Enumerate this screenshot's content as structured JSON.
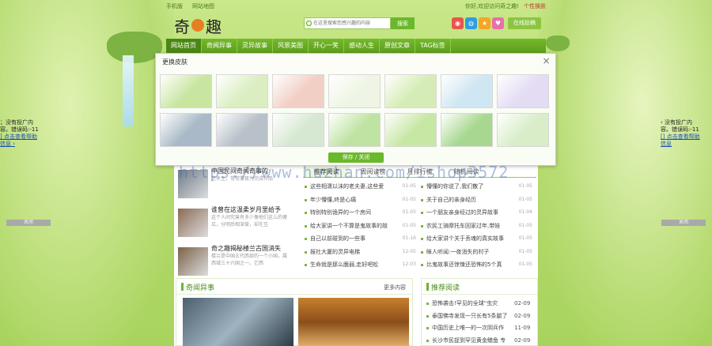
{
  "topbar": {
    "mobile": "手机版",
    "sitemap": "网站地图",
    "greeting": "你好,欢迎访问奇之趣!",
    "personal": "个性换肤"
  },
  "logo": {
    "text_a": "奇",
    "text_b": "趣"
  },
  "search": {
    "placeholder": "在这里搜索您感兴趣的内容",
    "button": "搜索"
  },
  "submit": "在线投稿",
  "social": [
    {
      "icon": "weibo-icon",
      "color": "#e8554e",
      "glyph": "◉"
    },
    {
      "icon": "qq-icon",
      "color": "#2f9ee0",
      "glyph": "◍"
    },
    {
      "icon": "star-icon",
      "color": "#f5a623",
      "glyph": "★"
    },
    {
      "icon": "heart-icon",
      "color": "#e96fa7",
      "glyph": "♥"
    }
  ],
  "nav": [
    "网站首页",
    "奇闻异事",
    "灵异故事",
    "风景美图",
    "开心一笑",
    "感动人生",
    "原创文章",
    "TAG标签"
  ],
  "modal": {
    "title": "更换皮肤",
    "save": "保存 / 关闭"
  },
  "skins": [
    "#c8e6a0",
    "#dbeec2",
    "#f2cfc5",
    "#eef5e4",
    "#d6ecb6",
    "#cfe6f3",
    "#e4dcf3",
    "#a9b9c7",
    "#b8c1c9",
    "#d7e8d2",
    "#bfe3a2",
    "#c7e7a5",
    "#a8d890",
    "#d8edc8"
  ],
  "featured": [
    {
      "title": "中国民间奇闻奇事的",
      "desc": "艺术生，常常熏夜为完成作品"
    },
    {
      "title": "谁曾在这温柔岁月里给予",
      "desc": "这个人间究竟有多少像他们这么的傻瓜，分明后相深爱，却在互"
    },
    {
      "title": "奇之趣揭秘楼兰古国消失",
      "desc": "楼兰是中国古代西部的一个小国，属西域三十六国之一。它西"
    }
  ],
  "tabs": [
    "推荐阅读",
    "周阅读榜",
    "月排行榜",
    "随机阅读"
  ],
  "list_left": [
    {
      "text": "这些相濡以沫的老夫妻,这些爱",
      "date": "01-05"
    },
    {
      "text": "年少懵懂,终是心痛",
      "date": "01-05"
    },
    {
      "text": "特别特别诡异的一个房间",
      "date": "01-05"
    },
    {
      "text": "给大家讲一个不算是鬼故事的故",
      "date": "01-05"
    },
    {
      "text": "自己以前碰到的一些事",
      "date": "01-16"
    },
    {
      "text": "报社大厦的灵异电梯",
      "date": "12-05"
    },
    {
      "text": "生命就是那么脆弱,走好吧松",
      "date": "12-03"
    }
  ],
  "list_right": [
    {
      "text": "懵懂的你说了,我们散了",
      "date": "01-05"
    },
    {
      "text": "关于自己的亲身经历",
      "date": "01-05"
    },
    {
      "text": "一个朋友亲身经过的灵异故事",
      "date": "01-04"
    },
    {
      "text": "农民工骑摩托车回家过年,带娃",
      "date": "01-05"
    },
    {
      "text": "给大家讲个关于丢魂的真实故事",
      "date": "01-05"
    },
    {
      "text": "眯人听闻:一夜消失的村子",
      "date": "01-05"
    },
    {
      "text": "比鬼故事还惊悚还恐怖的5个真",
      "date": "01-05"
    }
  ],
  "panel_left": {
    "title": "奇闻异事",
    "more": "更多内容"
  },
  "panel_right": {
    "title": "推荐阅读",
    "items": [
      {
        "text": "恐怖袭击!罕见的全球\"虫灾",
        "date": "02-09"
      },
      {
        "text": "泰国佛寺发现一只长有5条腿了",
        "date": "02-09"
      },
      {
        "text": "中国历史上唯一的一次阴兵作",
        "date": "11-09"
      },
      {
        "text": "长沙市民捉到罕见黄金鳝鱼 专",
        "date": "02-09"
      }
    ]
  },
  "ads": {
    "left": {
      "line1": "；没有投广内",
      "line2": "容。错误码:-11",
      "link": "] 点击查看帮助",
      "link2": "信息 ›",
      "close": "关闭"
    },
    "right": {
      "line1": "‹ 没有投广内",
      "line2": "容。错误码:-11",
      "link": "[] 点击查看帮助",
      "link2": "信息",
      "close": "关闭"
    }
  },
  "watermark": "https://www.huzhan.com/ishop3572"
}
